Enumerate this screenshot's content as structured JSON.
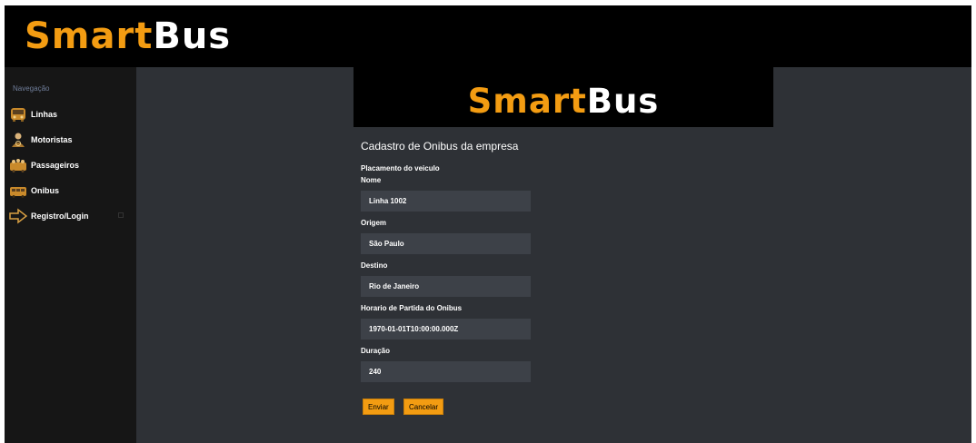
{
  "brand": {
    "part1": "Smart",
    "part2": "Bus"
  },
  "sidebar": {
    "title": "Navegação",
    "items": [
      {
        "label": "Linhas",
        "icon": "bus-front-icon"
      },
      {
        "label": "Motoristas",
        "icon": "driver-icon"
      },
      {
        "label": "Passageiros",
        "icon": "passengers-icon"
      },
      {
        "label": "Onibus",
        "icon": "bus-icon"
      },
      {
        "label": "Registro/Login",
        "icon": "login-arrow-icon"
      }
    ]
  },
  "form": {
    "title": "Cadastro de Onibus da empresa",
    "subtitle": "Placamento do veiculo",
    "fields": [
      {
        "label": "Nome",
        "value": "Linha 1002"
      },
      {
        "label": "Origem",
        "value": "São Paulo"
      },
      {
        "label": "Destino",
        "value": "Rio de Janeiro"
      },
      {
        "label": "Horario de Partida do Onibus",
        "value": "1970-01-01T10:00:00.000Z"
      },
      {
        "label": "Duração",
        "value": "240"
      }
    ],
    "submit_label": "Enviar",
    "cancel_label": "Cancelar"
  },
  "colors": {
    "accent": "#f39c12",
    "sidebar_bg": "#161616",
    "main_bg": "#2e3136",
    "input_bg": "#3d4148"
  }
}
